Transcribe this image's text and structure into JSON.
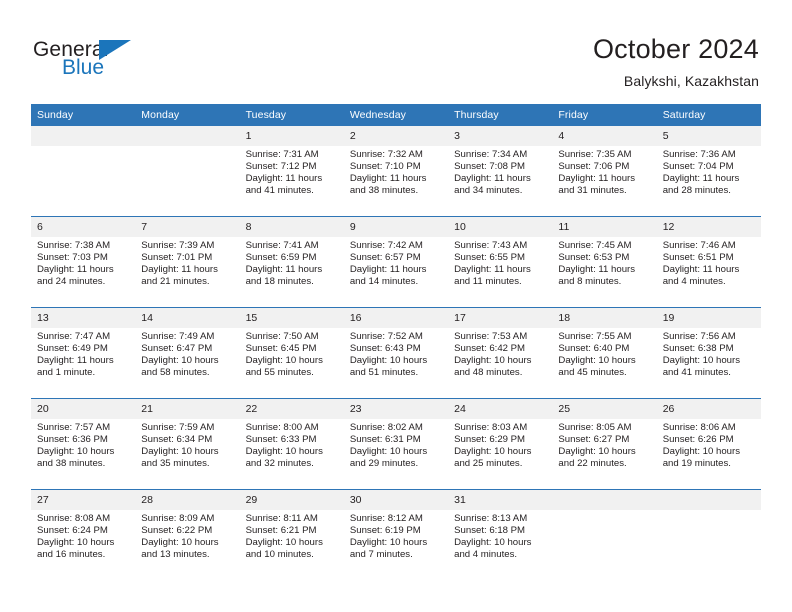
{
  "brand": {
    "word_one": "General",
    "word_two": "Blue",
    "accent_color": "#1b75bb"
  },
  "header": {
    "title": "October 2024",
    "subtitle": "Balykshi, Kazakhstan"
  },
  "theme": {
    "header_blue": "#2e75b6",
    "daynum_band": "#f1f1f1",
    "text": "#231f20"
  },
  "weekday_headers": [
    "Sunday",
    "Monday",
    "Tuesday",
    "Wednesday",
    "Thursday",
    "Friday",
    "Saturday"
  ],
  "labels": {
    "sunrise": "Sunrise:",
    "sunset": "Sunset:",
    "daylight": "Daylight:"
  },
  "weeks": [
    [
      {
        "day": "",
        "sunrise": "",
        "sunset": "",
        "daylight": "",
        "empty": true
      },
      {
        "day": "",
        "sunrise": "",
        "sunset": "",
        "daylight": "",
        "empty": true
      },
      {
        "day": "1",
        "sunrise": "Sunrise: 7:31 AM",
        "sunset": "Sunset: 7:12 PM",
        "daylight": "Daylight: 11 hours and 41 minutes."
      },
      {
        "day": "2",
        "sunrise": "Sunrise: 7:32 AM",
        "sunset": "Sunset: 7:10 PM",
        "daylight": "Daylight: 11 hours and 38 minutes."
      },
      {
        "day": "3",
        "sunrise": "Sunrise: 7:34 AM",
        "sunset": "Sunset: 7:08 PM",
        "daylight": "Daylight: 11 hours and 34 minutes."
      },
      {
        "day": "4",
        "sunrise": "Sunrise: 7:35 AM",
        "sunset": "Sunset: 7:06 PM",
        "daylight": "Daylight: 11 hours and 31 minutes."
      },
      {
        "day": "5",
        "sunrise": "Sunrise: 7:36 AM",
        "sunset": "Sunset: 7:04 PM",
        "daylight": "Daylight: 11 hours and 28 minutes."
      }
    ],
    [
      {
        "day": "6",
        "sunrise": "Sunrise: 7:38 AM",
        "sunset": "Sunset: 7:03 PM",
        "daylight": "Daylight: 11 hours and 24 minutes."
      },
      {
        "day": "7",
        "sunrise": "Sunrise: 7:39 AM",
        "sunset": "Sunset: 7:01 PM",
        "daylight": "Daylight: 11 hours and 21 minutes."
      },
      {
        "day": "8",
        "sunrise": "Sunrise: 7:41 AM",
        "sunset": "Sunset: 6:59 PM",
        "daylight": "Daylight: 11 hours and 18 minutes."
      },
      {
        "day": "9",
        "sunrise": "Sunrise: 7:42 AM",
        "sunset": "Sunset: 6:57 PM",
        "daylight": "Daylight: 11 hours and 14 minutes."
      },
      {
        "day": "10",
        "sunrise": "Sunrise: 7:43 AM",
        "sunset": "Sunset: 6:55 PM",
        "daylight": "Daylight: 11 hours and 11 minutes."
      },
      {
        "day": "11",
        "sunrise": "Sunrise: 7:45 AM",
        "sunset": "Sunset: 6:53 PM",
        "daylight": "Daylight: 11 hours and 8 minutes."
      },
      {
        "day": "12",
        "sunrise": "Sunrise: 7:46 AM",
        "sunset": "Sunset: 6:51 PM",
        "daylight": "Daylight: 11 hours and 4 minutes."
      }
    ],
    [
      {
        "day": "13",
        "sunrise": "Sunrise: 7:47 AM",
        "sunset": "Sunset: 6:49 PM",
        "daylight": "Daylight: 11 hours and 1 minute."
      },
      {
        "day": "14",
        "sunrise": "Sunrise: 7:49 AM",
        "sunset": "Sunset: 6:47 PM",
        "daylight": "Daylight: 10 hours and 58 minutes."
      },
      {
        "day": "15",
        "sunrise": "Sunrise: 7:50 AM",
        "sunset": "Sunset: 6:45 PM",
        "daylight": "Daylight: 10 hours and 55 minutes."
      },
      {
        "day": "16",
        "sunrise": "Sunrise: 7:52 AM",
        "sunset": "Sunset: 6:43 PM",
        "daylight": "Daylight: 10 hours and 51 minutes."
      },
      {
        "day": "17",
        "sunrise": "Sunrise: 7:53 AM",
        "sunset": "Sunset: 6:42 PM",
        "daylight": "Daylight: 10 hours and 48 minutes."
      },
      {
        "day": "18",
        "sunrise": "Sunrise: 7:55 AM",
        "sunset": "Sunset: 6:40 PM",
        "daylight": "Daylight: 10 hours and 45 minutes."
      },
      {
        "day": "19",
        "sunrise": "Sunrise: 7:56 AM",
        "sunset": "Sunset: 6:38 PM",
        "daylight": "Daylight: 10 hours and 41 minutes."
      }
    ],
    [
      {
        "day": "20",
        "sunrise": "Sunrise: 7:57 AM",
        "sunset": "Sunset: 6:36 PM",
        "daylight": "Daylight: 10 hours and 38 minutes."
      },
      {
        "day": "21",
        "sunrise": "Sunrise: 7:59 AM",
        "sunset": "Sunset: 6:34 PM",
        "daylight": "Daylight: 10 hours and 35 minutes."
      },
      {
        "day": "22",
        "sunrise": "Sunrise: 8:00 AM",
        "sunset": "Sunset: 6:33 PM",
        "daylight": "Daylight: 10 hours and 32 minutes."
      },
      {
        "day": "23",
        "sunrise": "Sunrise: 8:02 AM",
        "sunset": "Sunset: 6:31 PM",
        "daylight": "Daylight: 10 hours and 29 minutes."
      },
      {
        "day": "24",
        "sunrise": "Sunrise: 8:03 AM",
        "sunset": "Sunset: 6:29 PM",
        "daylight": "Daylight: 10 hours and 25 minutes."
      },
      {
        "day": "25",
        "sunrise": "Sunrise: 8:05 AM",
        "sunset": "Sunset: 6:27 PM",
        "daylight": "Daylight: 10 hours and 22 minutes."
      },
      {
        "day": "26",
        "sunrise": "Sunrise: 8:06 AM",
        "sunset": "Sunset: 6:26 PM",
        "daylight": "Daylight: 10 hours and 19 minutes."
      }
    ],
    [
      {
        "day": "27",
        "sunrise": "Sunrise: 8:08 AM",
        "sunset": "Sunset: 6:24 PM",
        "daylight": "Daylight: 10 hours and 16 minutes."
      },
      {
        "day": "28",
        "sunrise": "Sunrise: 8:09 AM",
        "sunset": "Sunset: 6:22 PM",
        "daylight": "Daylight: 10 hours and 13 minutes."
      },
      {
        "day": "29",
        "sunrise": "Sunrise: 8:11 AM",
        "sunset": "Sunset: 6:21 PM",
        "daylight": "Daylight: 10 hours and 10 minutes."
      },
      {
        "day": "30",
        "sunrise": "Sunrise: 8:12 AM",
        "sunset": "Sunset: 6:19 PM",
        "daylight": "Daylight: 10 hours and 7 minutes."
      },
      {
        "day": "31",
        "sunrise": "Sunrise: 8:13 AM",
        "sunset": "Sunset: 6:18 PM",
        "daylight": "Daylight: 10 hours and 4 minutes."
      },
      {
        "day": "",
        "sunrise": "",
        "sunset": "",
        "daylight": "",
        "empty": true
      },
      {
        "day": "",
        "sunrise": "",
        "sunset": "",
        "daylight": "",
        "empty": true
      }
    ]
  ]
}
